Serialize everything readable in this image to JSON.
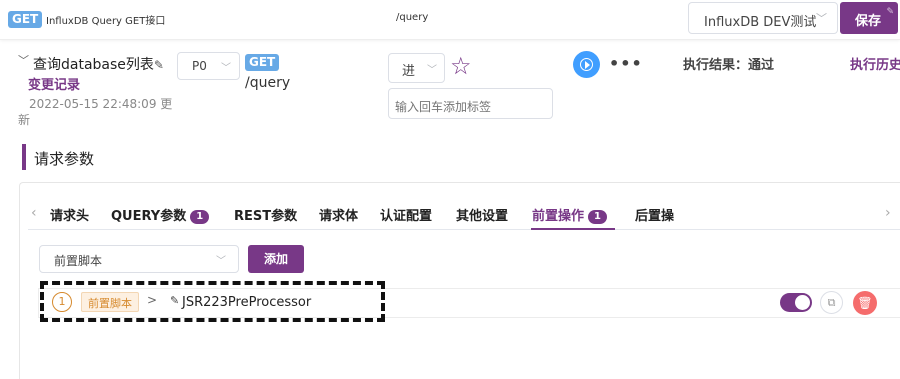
{
  "topbar": {
    "method": "GET",
    "title": "InfluxDB Query GET接口",
    "path": "/query",
    "environment": "InfluxDB DEV测试",
    "save_label": "保存"
  },
  "header": {
    "api_name": "查询database列表",
    "change_log": "变更记录",
    "update_time_line1": "2022-05-15 22:48:09 更",
    "update_time_line2": "新",
    "level": "P0",
    "method": "GET",
    "path": "/query",
    "status": "进",
    "tag_placeholder": "输入回车添加标签",
    "exec_result": "执行结果：通过",
    "exec_history": "执行历史"
  },
  "section": {
    "title": "请求参数"
  },
  "tabs": [
    {
      "label": "请求头"
    },
    {
      "label": "QUERY参数",
      "badge": "1"
    },
    {
      "label": "REST参数"
    },
    {
      "label": "请求体"
    },
    {
      "label": "认证配置"
    },
    {
      "label": "其他设置"
    },
    {
      "label": "前置操作",
      "badge": "1",
      "active": true
    },
    {
      "label": "后置操"
    }
  ],
  "pre_ops": {
    "script_type": "前置脚本",
    "add_label": "添加",
    "items": [
      {
        "index": "1",
        "tag": "前置脚本",
        "name": "JSR223PreProcessor",
        "enabled": true
      }
    ]
  },
  "colors": {
    "accent": "#783887",
    "run": "#409eff",
    "delete": "#f56c6c",
    "tag": "#d68a2e"
  }
}
